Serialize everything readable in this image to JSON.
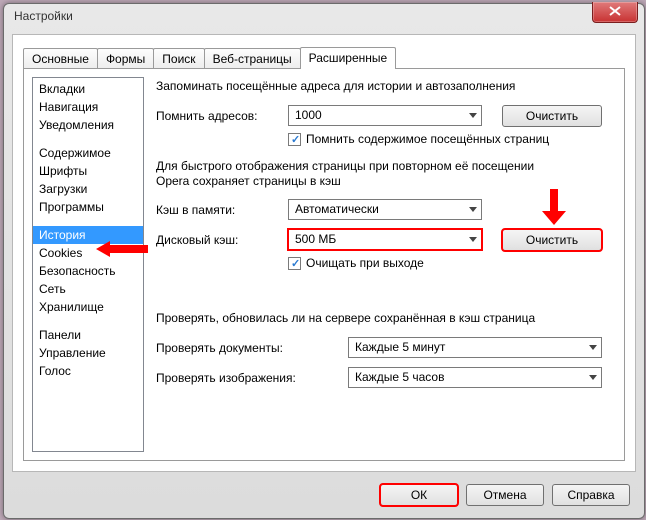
{
  "window": {
    "title": "Настройки"
  },
  "tabs": [
    "Основные",
    "Формы",
    "Поиск",
    "Веб-страницы",
    "Расширенные"
  ],
  "active_tab": 4,
  "sidebar": {
    "groups": [
      [
        "Вкладки",
        "Навигация",
        "Уведомления"
      ],
      [
        "Содержимое",
        "Шрифты",
        "Загрузки",
        "Программы"
      ],
      [
        "История",
        "Cookies",
        "Безопасность",
        "Сеть",
        "Хранилище"
      ],
      [
        "Панели",
        "Управление",
        "Голос"
      ]
    ],
    "selected": "История"
  },
  "content": {
    "section1_title": "Запоминать посещённые адреса для истории и автозаполнения",
    "addresses_label": "Помнить адресов:",
    "addresses_value": "1000",
    "clear_btn": "Очистить",
    "remember_content_chk": "Помнить содержимое посещённых страниц",
    "section2_line1": "Для быстрого отображения страницы при повторном её посещении",
    "section2_line2": "Opera сохраняет страницы в кэш",
    "mem_cache_label": "Кэш в памяти:",
    "mem_cache_value": "Автоматически",
    "disk_cache_label": "Дисковый кэш:",
    "disk_cache_value": "500 МБ",
    "clear_on_exit_chk": "Очищать при выходе",
    "section3_title": "Проверять, обновилась ли на сервере сохранённая в кэш страница",
    "check_docs_label": "Проверять документы:",
    "check_docs_value": "Каждые 5 минут",
    "check_imgs_label": "Проверять изображения:",
    "check_imgs_value": "Каждые 5 часов"
  },
  "footer": {
    "ok": "ОК",
    "cancel": "Отмена",
    "help": "Справка"
  }
}
